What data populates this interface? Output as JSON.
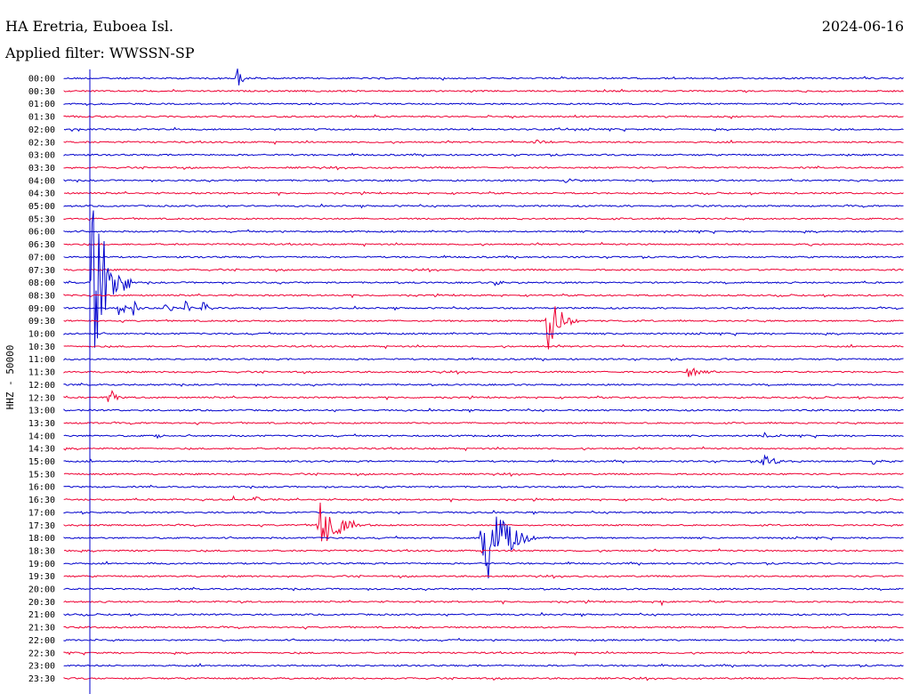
{
  "header": {
    "station": "HA Eretria, Euboea Isl.",
    "date": "2024-06-16",
    "filter": "Applied filter: WWSSN-SP"
  },
  "chart_data": {
    "type": "line",
    "title": "HA Eretria, Euboea Isl.",
    "ylabel": "HHZ - 50000",
    "row_labels": [
      "00:00",
      "00:30",
      "01:00",
      "01:30",
      "02:00",
      "02:30",
      "03:00",
      "03:30",
      "04:00",
      "04:30",
      "05:00",
      "05:30",
      "06:00",
      "06:30",
      "07:00",
      "07:30",
      "08:00",
      "08:30",
      "09:00",
      "09:30",
      "10:00",
      "10:30",
      "11:00",
      "11:30",
      "12:00",
      "12:30",
      "13:00",
      "13:30",
      "14:00",
      "14:30",
      "15:00",
      "15:30",
      "16:00",
      "16:30",
      "17:00",
      "17:30",
      "18:00",
      "18:30",
      "19:00",
      "19:30",
      "20:00",
      "20:30",
      "21:00",
      "21:30",
      "22:00",
      "22:30",
      "23:00",
      "23:30"
    ],
    "colors": [
      "#0000cc",
      "#ee0033"
    ],
    "row_minutes": 30,
    "grid": false,
    "events": [
      {
        "row": 0,
        "minute": 6.1,
        "amp": 14,
        "dur": 0.8
      },
      {
        "row": 5,
        "minute": 16.8,
        "amp": 5,
        "dur": 0.7
      },
      {
        "row": 8,
        "minute": 17.8,
        "amp": 4,
        "dur": 0.8
      },
      {
        "row": 11,
        "minute": 16.3,
        "amp": 2,
        "dur": 0.3
      },
      {
        "row": 13,
        "minute": 26.6,
        "amp": 3,
        "dur": 0.5
      },
      {
        "row": 16,
        "minute": 0.9,
        "amp": 110,
        "dur": 1.5
      },
      {
        "row": 16,
        "minute": 15.3,
        "amp": 6,
        "dur": 0.6
      },
      {
        "row": 18,
        "minute": 1.9,
        "amp": 10,
        "dur": 0.8
      },
      {
        "row": 18,
        "minute": 2.4,
        "amp": 12,
        "dur": 0.4
      },
      {
        "row": 18,
        "minute": 3.6,
        "amp": 8,
        "dur": 0.5
      },
      {
        "row": 18,
        "minute": 4.9,
        "amp": 12,
        "dur": 0.5
      },
      {
        "row": 18,
        "minute": 4.3,
        "amp": 8,
        "dur": 0.4
      },
      {
        "row": 19,
        "minute": 17.2,
        "amp": 38,
        "dur": 1.2
      },
      {
        "row": 23,
        "minute": 22.2,
        "amp": 10,
        "dur": 1.2
      },
      {
        "row": 25,
        "minute": 1.6,
        "amp": 15,
        "dur": 0.5
      },
      {
        "row": 28,
        "minute": 3.3,
        "amp": 4,
        "dur": 0.3
      },
      {
        "row": 28,
        "minute": 25.0,
        "amp": 5,
        "dur": 0.3
      },
      {
        "row": 30,
        "minute": 24.8,
        "amp": 7,
        "dur": 1.6
      },
      {
        "row": 30,
        "minute": 28.8,
        "amp": 6,
        "dur": 0.5
      },
      {
        "row": 33,
        "minute": 6.0,
        "amp": 6,
        "dur": 0.3
      },
      {
        "row": 33,
        "minute": 6.8,
        "amp": 7,
        "dur": 0.6
      },
      {
        "row": 35,
        "minute": 9.0,
        "amp": 28,
        "dur": 2.0
      },
      {
        "row": 36,
        "minute": 14.9,
        "amp": 58,
        "dur": 2.0
      },
      {
        "row": 41,
        "minute": 6.3,
        "amp": 3,
        "dur": 0.3
      },
      {
        "row": 41,
        "minute": 21.3,
        "amp": 5,
        "dur": 0.3
      },
      {
        "row": 42,
        "minute": 26.5,
        "amp": 3,
        "dur": 0.3
      },
      {
        "row": 43,
        "minute": 12.6,
        "amp": 3,
        "dur": 0.6
      }
    ]
  }
}
